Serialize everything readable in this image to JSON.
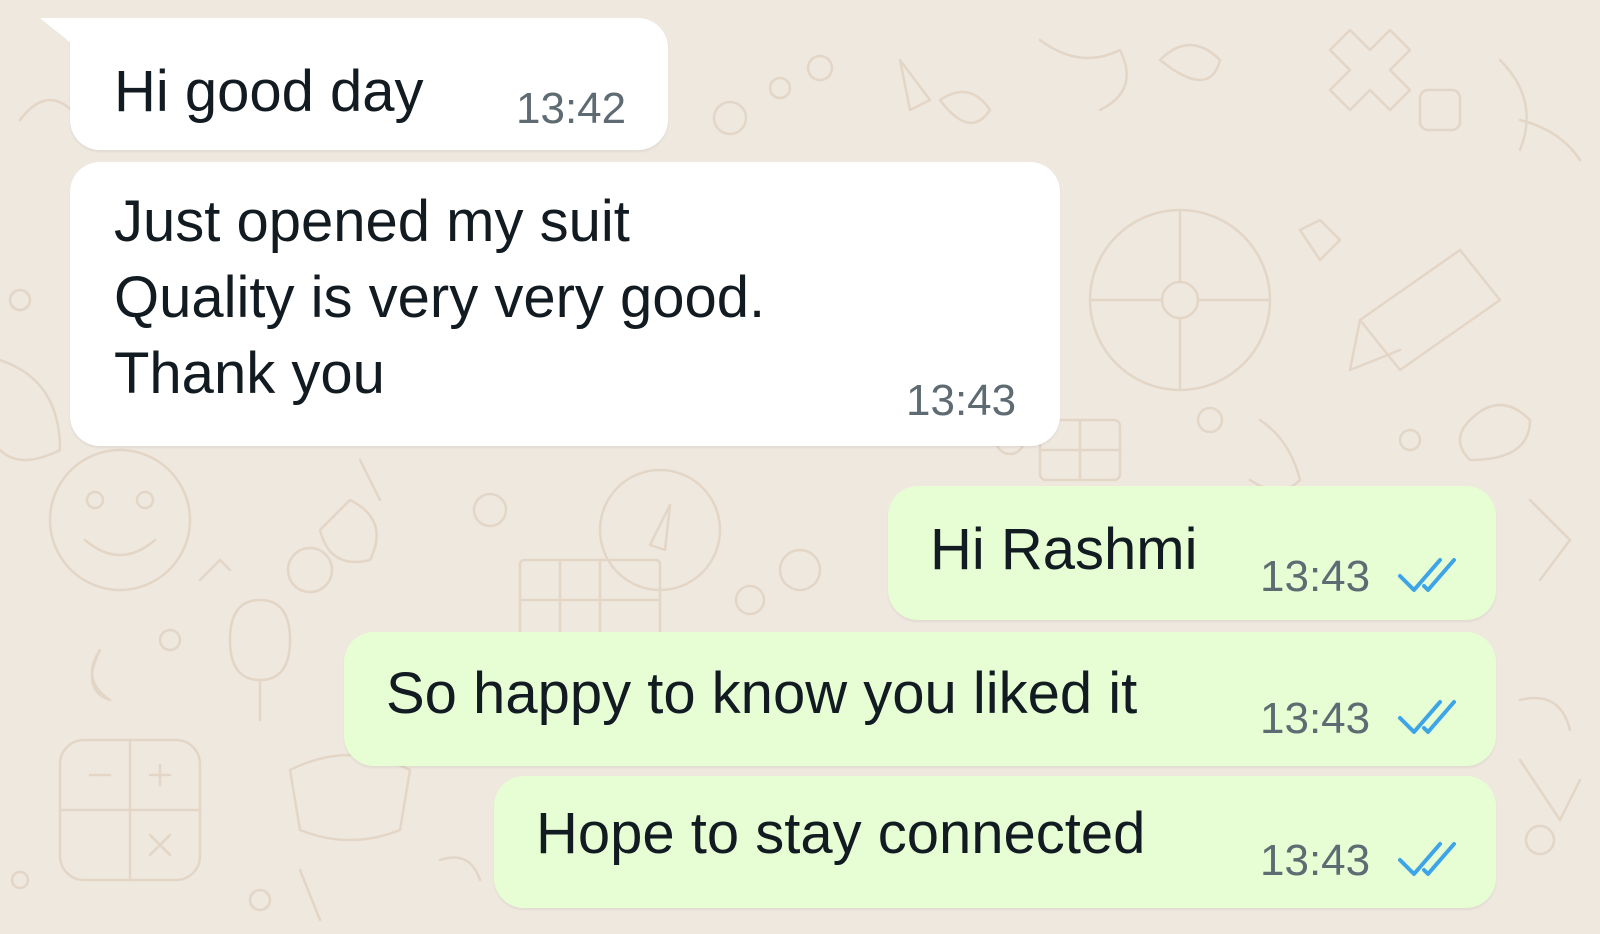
{
  "chat": {
    "messages": [
      {
        "direction": "incoming",
        "text": "Hi good day",
        "time": "13:42"
      },
      {
        "direction": "incoming",
        "text": "Just opened my suit\nQuality is very very good.\nThank you",
        "time": "13:43"
      },
      {
        "direction": "outgoing",
        "text": "Hi Rashmi",
        "time": "13:43",
        "status_icon": "double-check-read-icon"
      },
      {
        "direction": "outgoing",
        "text": "So happy to know you liked it",
        "time": "13:43",
        "status_icon": "double-check-read-icon"
      },
      {
        "direction": "outgoing",
        "text": "Hope to stay connected",
        "time": "13:43",
        "status_icon": "double-check-read-icon"
      }
    ]
  },
  "theme": {
    "background": "#efe8df",
    "incoming_bubble": "#ffffff",
    "outgoing_bubble": "#e7fdd4",
    "read_tick": "#3ea4e8"
  }
}
